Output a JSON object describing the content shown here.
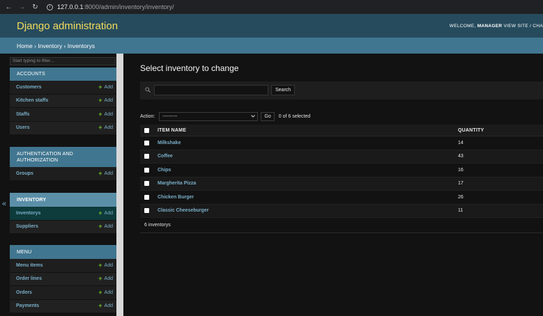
{
  "browser": {
    "url_host": "127.0.0.1",
    "url_path": ":8000/admin/inventory/inventory/"
  },
  "header": {
    "title": "Django administration",
    "welcome": "WELCOME,",
    "user": "MANAGER",
    "links": "VIEW SITE / CHA"
  },
  "breadcrumbs": "Home › Inventory › Inventorys",
  "sidebar": {
    "filter_placeholder": "Start typing to filter...",
    "add_label": "Add",
    "modules": [
      {
        "caption": "ACCOUNTS",
        "models": [
          "Customers",
          "Kitchen staffs",
          "Staffs",
          "Users"
        ]
      },
      {
        "caption": "AUTHENTICATION AND AUTHORIZATION",
        "models": [
          "Groups"
        ]
      },
      {
        "caption": "INVENTORY",
        "models": [
          "Inventorys",
          "Suppliers"
        ]
      },
      {
        "caption": "MENU",
        "models": [
          "Menu items",
          "Order lines",
          "Orders",
          "Payments"
        ]
      }
    ],
    "toggle": "«"
  },
  "content": {
    "title": "Select inventory to change",
    "search_button": "Search",
    "action_label": "Action:",
    "action_selected": "---------",
    "go_button": "Go",
    "selected_count": "0 of 6 selected",
    "columns": [
      "ITEM NAME",
      "QUANTITY"
    ],
    "rows": [
      {
        "name": "Milkshake",
        "qty": "14"
      },
      {
        "name": "Coffee",
        "qty": "43"
      },
      {
        "name": "Chips",
        "qty": "16"
      },
      {
        "name": "Margherita Pizza",
        "qty": "17"
      },
      {
        "name": "Chicken Burger",
        "qty": "26"
      },
      {
        "name": "Classic Cheeseburger",
        "qty": "11"
      }
    ],
    "paginator": "6 inventorys"
  },
  "colors": {
    "header_bg": "#264b5d",
    "breadcrumb_bg": "#417690",
    "title_yellow": "#f5dd5d",
    "link_blue": "#79aec8",
    "add_green": "#70bf2b"
  }
}
